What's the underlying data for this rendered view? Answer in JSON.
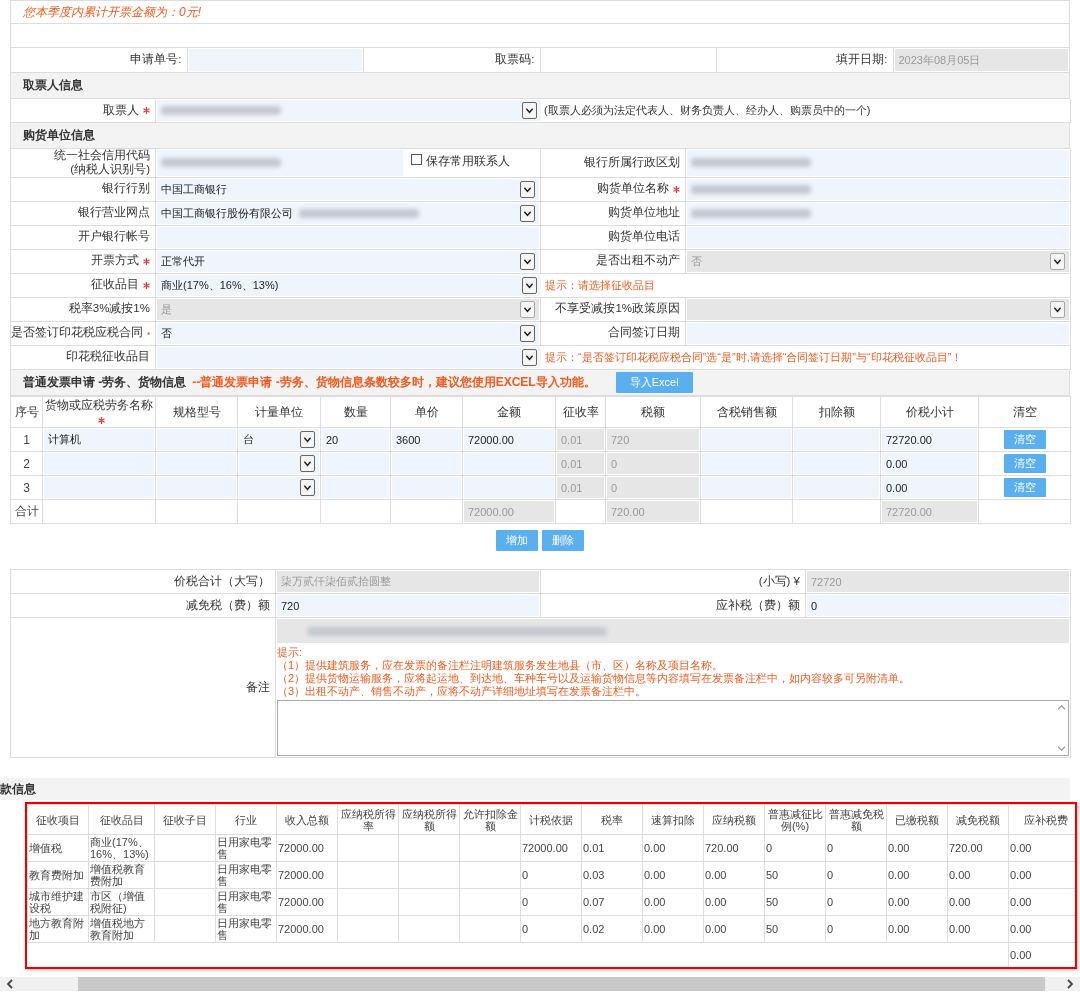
{
  "notice": "您本季度内累计开票金额为：0元!",
  "header_fields": [
    {
      "label": "申请单号:",
      "kind": "input",
      "disabled": false
    },
    {
      "label": "取票码:",
      "kind": "plain",
      "disabled": false
    },
    {
      "label": "填开日期:",
      "kind": "input",
      "value": "2023年08月05日",
      "disabled": true
    }
  ],
  "sections": [
    {
      "title": "取票人信息",
      "rows": [
        {
          "fields": [
            {
              "label": "取票人",
              "required": true,
              "kind": "select",
              "redacted": true,
              "disabled": false,
              "note": "(取票人必须为法定代表人、财务负责人、经办人、购票员中的一个)"
            }
          ]
        }
      ]
    },
    {
      "title": "购货单位信息",
      "rows": [
        {
          "fields": [
            {
              "label": "统一社会信用代码\n(纳税人识别号)",
              "kind": "input",
              "redacted": true,
              "disabled": false,
              "checkbox": {
                "label": "保存常用联系人",
                "checked": false
              }
            },
            {
              "label": "银行所属行政区划",
              "kind": "input",
              "redacted": true,
              "disabled": false
            }
          ]
        },
        {
          "fields": [
            {
              "label": "银行行别",
              "kind": "select",
              "value": "中国工商银行",
              "disabled": false
            },
            {
              "label": "购货单位名称",
              "required": true,
              "kind": "input",
              "redacted": true,
              "disabled": false
            }
          ]
        },
        {
          "fields": [
            {
              "label": "银行营业网点",
              "kind": "select",
              "value": "中国工商银行股份有限公司",
              "redacted": true,
              "disabled": false
            },
            {
              "label": "购货单位地址",
              "kind": "input",
              "redacted": true,
              "disabled": false
            }
          ]
        },
        {
          "fields": [
            {
              "label": "开户银行帐号",
              "kind": "input",
              "disabled": false
            },
            {
              "label": "购货单位电话",
              "kind": "input",
              "disabled": false
            }
          ]
        },
        {
          "fields": [
            {
              "label": "开票方式",
              "required": true,
              "kind": "select",
              "value": "正常代开",
              "disabled": false
            },
            {
              "label": "是否出租不动产",
              "kind": "select",
              "value": "否",
              "disabled": true
            }
          ]
        },
        {
          "fields": [
            {
              "label": "征收品目",
              "required": true,
              "kind": "select",
              "value": "商业(17%、16%、13%)",
              "disabled": false,
              "hint": "提示：请选择征收品目"
            }
          ]
        },
        {
          "fields": [
            {
              "label": "税率3%减按1%",
              "kind": "select",
              "value": "是",
              "disabled": true
            },
            {
              "label": "不享受减按1%政策原因",
              "kind": "select",
              "disabled": true
            }
          ]
        },
        {
          "fields": [
            {
              "label": "是否签订印花税应税合同",
              "required": true,
              "kind": "select",
              "value": "否",
              "disabled": false
            },
            {
              "label": "合同签订日期",
              "kind": "input",
              "disabled": false
            }
          ]
        },
        {
          "fields": [
            {
              "label": "印花税征收品目",
              "kind": "select",
              "disabled": false,
              "hint": "提示：“是否签订印花税应税合同”选“是”时,请选择“合同签订日期”与“印花税征收品目”！"
            }
          ]
        }
      ]
    }
  ],
  "goods": {
    "title": "普通发票申请 -劳务、货物信息",
    "hint": "--普通发票申请 -劳务、货物信息条数较多时，建议您使用EXCEL导入功能。",
    "import_button": "导入Excel",
    "columns": [
      {
        "label": "序号"
      },
      {
        "label": "货物或应税劳务名称",
        "required": true
      },
      {
        "label": "规格型号"
      },
      {
        "label": "计量单位"
      },
      {
        "label": "数量"
      },
      {
        "label": "单价"
      },
      {
        "label": "金额"
      },
      {
        "label": "征收率"
      },
      {
        "label": "税额"
      },
      {
        "label": "含税销售额"
      },
      {
        "label": "扣除额"
      },
      {
        "label": "价税小计"
      },
      {
        "label": "清空"
      }
    ],
    "rows": [
      {
        "cells": [
          {
            "kind": "index",
            "value": "1"
          },
          {
            "kind": "input",
            "value": "计算机",
            "disabled": false
          },
          {
            "kind": "input",
            "disabled": false
          },
          {
            "kind": "select",
            "value": "台",
            "disabled": false
          },
          {
            "kind": "input",
            "value": "20",
            "disabled": false
          },
          {
            "kind": "input",
            "value": "3600",
            "disabled": false
          },
          {
            "kind": "input",
            "value": "72000.00",
            "disabled": false
          },
          {
            "kind": "input",
            "value": "0.01",
            "disabled": true
          },
          {
            "kind": "input",
            "value": "720",
            "disabled": true
          },
          {
            "kind": "input",
            "disabled": false
          },
          {
            "kind": "input",
            "disabled": false
          },
          {
            "kind": "input",
            "value": "72720.00",
            "disabled": false
          },
          {
            "kind": "button",
            "value": "清空"
          }
        ]
      },
      {
        "cells": [
          {
            "kind": "index",
            "value": "2"
          },
          {
            "kind": "input",
            "disabled": false
          },
          {
            "kind": "input",
            "disabled": false
          },
          {
            "kind": "select",
            "disabled": false
          },
          {
            "kind": "input",
            "disabled": false
          },
          {
            "kind": "input",
            "disabled": false
          },
          {
            "kind": "input",
            "disabled": false
          },
          {
            "kind": "input",
            "value": "0.01",
            "disabled": true
          },
          {
            "kind": "input",
            "value": "0",
            "disabled": true
          },
          {
            "kind": "input",
            "disabled": false
          },
          {
            "kind": "input",
            "disabled": false
          },
          {
            "kind": "input",
            "value": "0.00",
            "disabled": false
          },
          {
            "kind": "button",
            "value": "清空"
          }
        ]
      },
      {
        "cells": [
          {
            "kind": "index",
            "value": "3"
          },
          {
            "kind": "input",
            "disabled": false
          },
          {
            "kind": "input",
            "disabled": false
          },
          {
            "kind": "select",
            "disabled": false
          },
          {
            "kind": "input",
            "disabled": false
          },
          {
            "kind": "input",
            "disabled": false
          },
          {
            "kind": "input",
            "disabled": false
          },
          {
            "kind": "input",
            "value": "0.01",
            "disabled": true
          },
          {
            "kind": "input",
            "value": "0",
            "disabled": true
          },
          {
            "kind": "input",
            "disabled": false
          },
          {
            "kind": "input",
            "disabled": false
          },
          {
            "kind": "input",
            "value": "0.00",
            "disabled": false
          },
          {
            "kind": "button",
            "value": "清空"
          }
        ]
      },
      {
        "cells": [
          {
            "kind": "label",
            "value": "合计"
          },
          {
            "kind": "blank"
          },
          {
            "kind": "blank"
          },
          {
            "kind": "blank"
          },
          {
            "kind": "blank"
          },
          {
            "kind": "blank"
          },
          {
            "kind": "input",
            "value": "72000.00",
            "disabled": true
          },
          {
            "kind": "blank"
          },
          {
            "kind": "input",
            "value": "720.00",
            "disabled": true
          },
          {
            "kind": "blank"
          },
          {
            "kind": "blank"
          },
          {
            "kind": "input",
            "value": "72720.00",
            "disabled": true
          },
          {
            "kind": "blank"
          }
        ]
      }
    ],
    "buttons": [
      "增加",
      "删除"
    ]
  },
  "summary": {
    "rows": [
      [
        {
          "label": "价税合计（大写）",
          "value": "柒万贰仟柒佰贰拾圆整",
          "disabled": true
        },
        {
          "label": "(小写) ¥",
          "value": "72720",
          "disabled": true
        }
      ],
      [
        {
          "label": "减免税（费）额",
          "value": "720",
          "disabled": false
        },
        {
          "label": "应补税（费）额",
          "value": "0",
          "disabled": false
        }
      ]
    ],
    "remarks": {
      "label": "备注",
      "redacted": true,
      "hints": [
        "提示:",
        "（1）提供建筑服务，应在发票的备注栏注明建筑服务发生地县（市、区）名称及项目名称。",
        "（2）提供货物运输服务，应将起运地、到达地、车种车号以及运输货物信息等内容填写在发票备注栏中，如内容较多可另附清单。",
        "（3）出租不动产、销售不动产，应将不动产详细地址填写在发票备注栏中。"
      ]
    }
  },
  "tax": {
    "title": "款信息",
    "highlighted": true,
    "columns": [
      "征收项目",
      "征收品目",
      "征收子目",
      "行业",
      "收入总额",
      "应纳税所得率",
      "应纳税所得额",
      "允许扣除金额",
      "计税依据",
      "税率",
      "速算扣除",
      "应纳税额",
      "普惠减征比例(%)",
      "普惠减免税额",
      "已缴税额",
      "减免税额",
      "应补税费"
    ],
    "rows": [
      [
        "增值税",
        "商业(17%、16%、13%)",
        null,
        "日用家电零售",
        "72000.00",
        null,
        null,
        null,
        "72000.00",
        "0.01",
        "0.00",
        "720.00",
        "0",
        "0",
        "0.00",
        "720.00",
        "0.00"
      ],
      [
        "教育费附加",
        "增值税教育费附加",
        null,
        "日用家电零售",
        "72000.00",
        null,
        null,
        null,
        "0",
        "0.03",
        "0.00",
        "0.00",
        "50",
        "0",
        "0.00",
        "0.00",
        "0.00"
      ],
      [
        "城市维护建设税",
        "市区（增值税附征)",
        null,
        "日用家电零售",
        "72000.00",
        null,
        null,
        null,
        "0",
        "0.07",
        "0.00",
        "0.00",
        "50",
        "0",
        "0.00",
        "0.00",
        "0.00"
      ],
      [
        "地方教育附加",
        "增值税地方教育附加",
        null,
        "日用家电零售",
        "72000.00",
        null,
        null,
        null,
        "0",
        "0.02",
        "0.00",
        "0.00",
        "50",
        "0",
        "0.00",
        "0.00",
        "0.00"
      ]
    ],
    "total": "0.00"
  }
}
